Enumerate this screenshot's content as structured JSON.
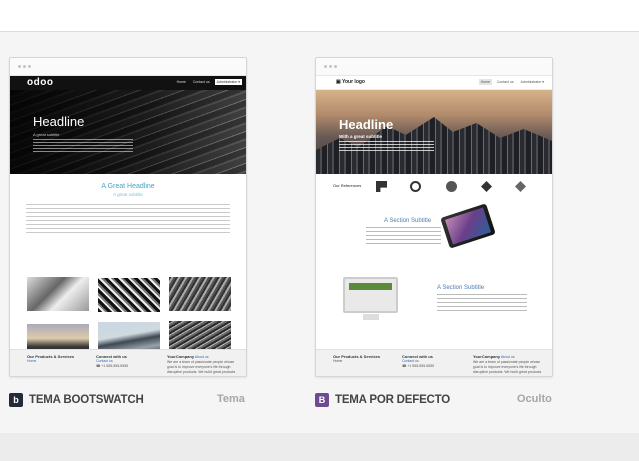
{
  "themes": [
    {
      "title": "TEMA BOOTSWATCH",
      "status": "Tema",
      "badge": "b",
      "badge_color": "#252a3a",
      "preview": {
        "logo": "odoo",
        "nav": [
          "Home",
          "Contact us",
          "Administrator ▾"
        ],
        "headline": "Headline",
        "subtitle": "A great subtitle",
        "section_title": "A Great Headline",
        "section_subtitle": "A great subtitle",
        "footer": {
          "col1_title": "Our Products & Services",
          "col1_link": "Home",
          "col2_title": "Connect with us",
          "col2_link": "Contact us",
          "col2_phone": "☎ +1 555-555-5555",
          "col3_title": "YourCompany",
          "col3_link": "About us",
          "col3_text": "We are a team of passionate people whose goal is to improve everyone's life through disruptive products. We build great products"
        }
      }
    },
    {
      "title": "TEMA POR DEFECTO",
      "status": "Oculto",
      "badge": "B",
      "badge_color": "#6e4a92",
      "preview": {
        "logo": "▣ Your logo",
        "nav": [
          "Home",
          "Contact us",
          "Administrator ▾"
        ],
        "headline": "Headline",
        "subtitle": "With a great subtitle",
        "references_label": "Our References",
        "section1_title": "A Section Subtitle",
        "section2_title": "A Section Subtitle",
        "footer": {
          "col1_title": "Our Products & Services",
          "col1_link": "Home",
          "col2_title": "Connect with us",
          "col2_link": "Contact us",
          "col2_phone": "☎ +1 555-555-5555",
          "col3_title": "YourCompany",
          "col3_link": "About us",
          "col3_text": "We are a team of passionate people whose goal is to improve everyone's life through disruptive products. We build great products"
        }
      }
    }
  ]
}
